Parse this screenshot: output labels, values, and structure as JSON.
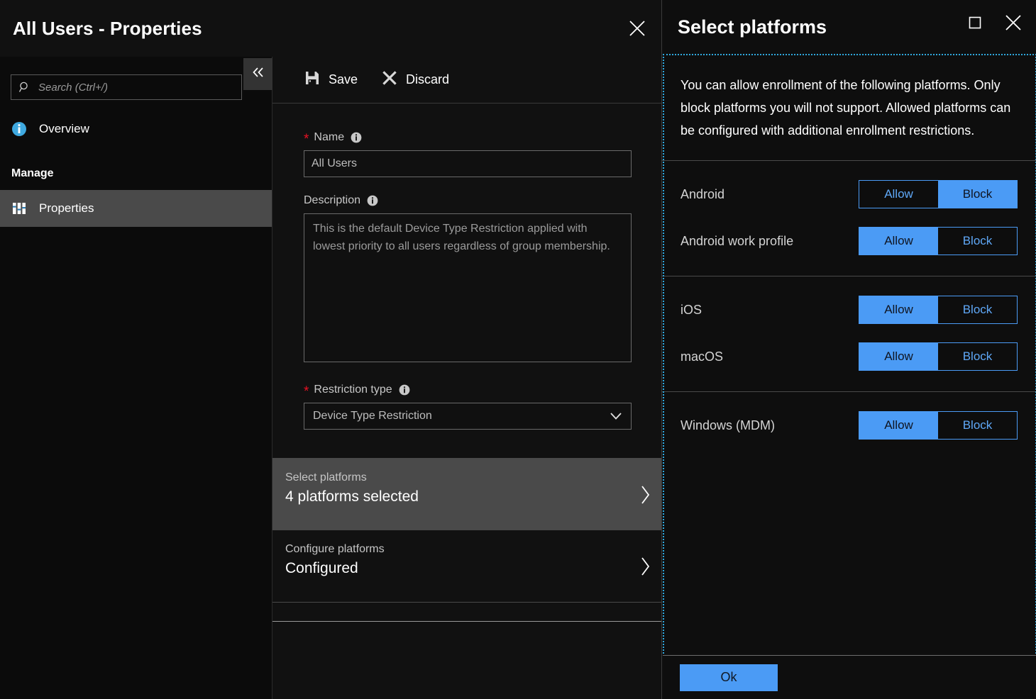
{
  "blade": {
    "title": "All Users - Properties",
    "close_icon": "close-icon",
    "collapse_icon": "chevron-double-left-icon"
  },
  "search": {
    "placeholder": "Search (Ctrl+/)",
    "value": "",
    "icon": "search-icon"
  },
  "sidebar": {
    "items": [
      {
        "label": "Overview",
        "icon": "info-circle-icon",
        "selected": false
      },
      {
        "label": "Properties",
        "icon": "properties-bars-icon",
        "selected": true
      }
    ],
    "group_label": "Manage"
  },
  "toolbar": {
    "save_label": "Save",
    "save_icon": "save-disk-icon",
    "discard_label": "Discard",
    "discard_icon": "close-x-icon"
  },
  "form": {
    "name": {
      "label": "Name",
      "required": true,
      "value": "All Users",
      "info_icon": "info-icon"
    },
    "description": {
      "label": "Description",
      "required": false,
      "value": "This is the default Device Type Restriction applied with lowest priority to all users regardless of group membership.",
      "info_icon": "info-icon"
    },
    "restriction_type": {
      "label": "Restriction type",
      "required": true,
      "value": "Device Type Restriction",
      "info_icon": "info-icon",
      "chevron_icon": "chevron-down-icon"
    }
  },
  "picker_rows": [
    {
      "caption": "Select platforms",
      "value": "4 platforms selected",
      "active": true,
      "chevron_icon": "chevron-right-icon"
    },
    {
      "caption": "Configure platforms",
      "value": "Configured",
      "active": false,
      "chevron_icon": "chevron-right-icon"
    }
  ],
  "right_panel": {
    "title": "Select platforms",
    "maximize_icon": "maximize-square-icon",
    "close_icon": "close-icon",
    "intro": "You can allow enrollment of the following platforms. Only block platforms you will not support. Allowed platforms can be configured with additional enrollment restrictions.",
    "allow_label": "Allow",
    "block_label": "Block",
    "groups": [
      {
        "rows": [
          {
            "name": "Android",
            "selected": "Block"
          },
          {
            "name": "Android work profile",
            "selected": "Allow"
          }
        ]
      },
      {
        "rows": [
          {
            "name": "iOS",
            "selected": "Allow"
          },
          {
            "name": "macOS",
            "selected": "Allow"
          }
        ]
      },
      {
        "rows": [
          {
            "name": "Windows (MDM)",
            "selected": "Allow"
          }
        ]
      }
    ],
    "ok_label": "Ok"
  },
  "colors": {
    "accent": "#4b9bf5",
    "required_star": "#e81123",
    "focus_outline": "#2fa8dd",
    "info_icon": "#c8c8c8"
  }
}
